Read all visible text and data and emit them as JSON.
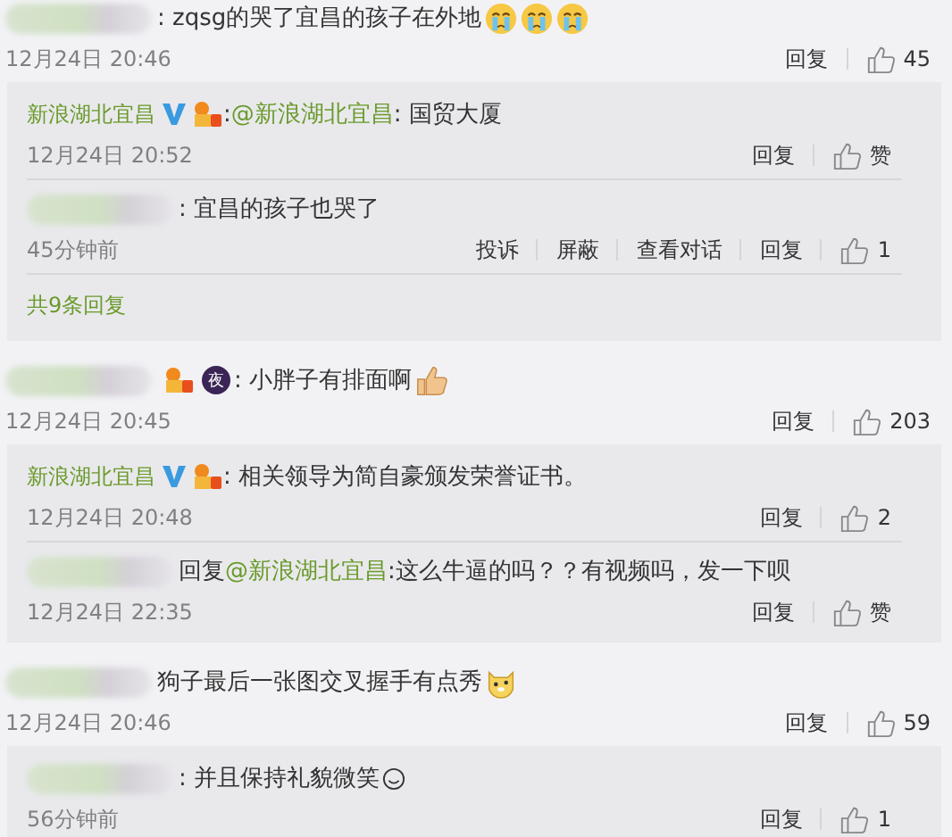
{
  "comments": [
    {
      "author": {
        "kind": "hidden"
      },
      "content": [
        {
          "kind": "text",
          "text": ": zqsg的哭了宜昌的孩子在外地"
        },
        {
          "kind": "crying"
        },
        {
          "kind": "crying"
        },
        {
          "kind": "crying"
        }
      ],
      "time": "12月24日 20:46",
      "actions": [
        "回复"
      ],
      "like": "45",
      "replies": [
        {
          "author": {
            "kind": "named",
            "name": "新浪湖北宜昌",
            "verified": true,
            "medal": true
          },
          "content": [
            {
              "kind": "text",
              "text": ": "
            },
            {
              "kind": "link",
              "text": "@新浪湖北宜昌"
            },
            {
              "kind": "text",
              "text": ": 国贸大厦"
            }
          ],
          "time": "12月24日 20:52",
          "actions": [
            "回复"
          ],
          "like": "赞"
        },
        {
          "author": {
            "kind": "hidden"
          },
          "content": [
            {
              "kind": "text",
              "text": ": 宜昌的孩子也哭了"
            }
          ],
          "time": "45分钟前",
          "actions": [
            "投诉",
            "屏蔽",
            "查看对话",
            "回复"
          ],
          "like": "1"
        }
      ],
      "more": "共9条回复"
    },
    {
      "author": {
        "kind": "hidden",
        "medal": true,
        "badge_text": "夜"
      },
      "content": [
        {
          "kind": "text",
          "text": ": 小胖子有排面啊"
        },
        {
          "kind": "thumbsup"
        }
      ],
      "time": "12月24日 20:45",
      "actions": [
        "回复"
      ],
      "like": "203",
      "replies": [
        {
          "author": {
            "kind": "named",
            "name": "新浪湖北宜昌",
            "verified": true,
            "medal": true
          },
          "content": [
            {
              "kind": "text",
              "text": ": 相关领导为简自豪颁发荣誉证书。"
            }
          ],
          "time": "12月24日 20:48",
          "actions": [
            "回复"
          ],
          "like": "2"
        },
        {
          "author": {
            "kind": "hidden"
          },
          "content": [
            {
              "kind": "text",
              "text": "回复"
            },
            {
              "kind": "link",
              "text": "@新浪湖北宜昌"
            },
            {
              "kind": "text",
              "text": ":这么牛逼的吗？？有视频吗，发一下呗"
            }
          ],
          "time": "12月24日 22:35",
          "actions": [
            "回复"
          ],
          "like": "赞"
        }
      ]
    },
    {
      "author": {
        "kind": "hidden"
      },
      "content": [
        {
          "kind": "text",
          "text": "狗子最后一张图交叉握手有点秀"
        },
        {
          "kind": "dog"
        }
      ],
      "time": "12月24日 20:46",
      "actions": [
        "回复"
      ],
      "like": "59",
      "replies": [
        {
          "author": {
            "kind": "hidden"
          },
          "content": [
            {
              "kind": "text",
              "text": ": 并且保持礼貌微笑"
            },
            {
              "kind": "smile"
            }
          ],
          "time": "56分钟前",
          "actions": [
            "回复"
          ],
          "like": "1"
        }
      ]
    }
  ]
}
